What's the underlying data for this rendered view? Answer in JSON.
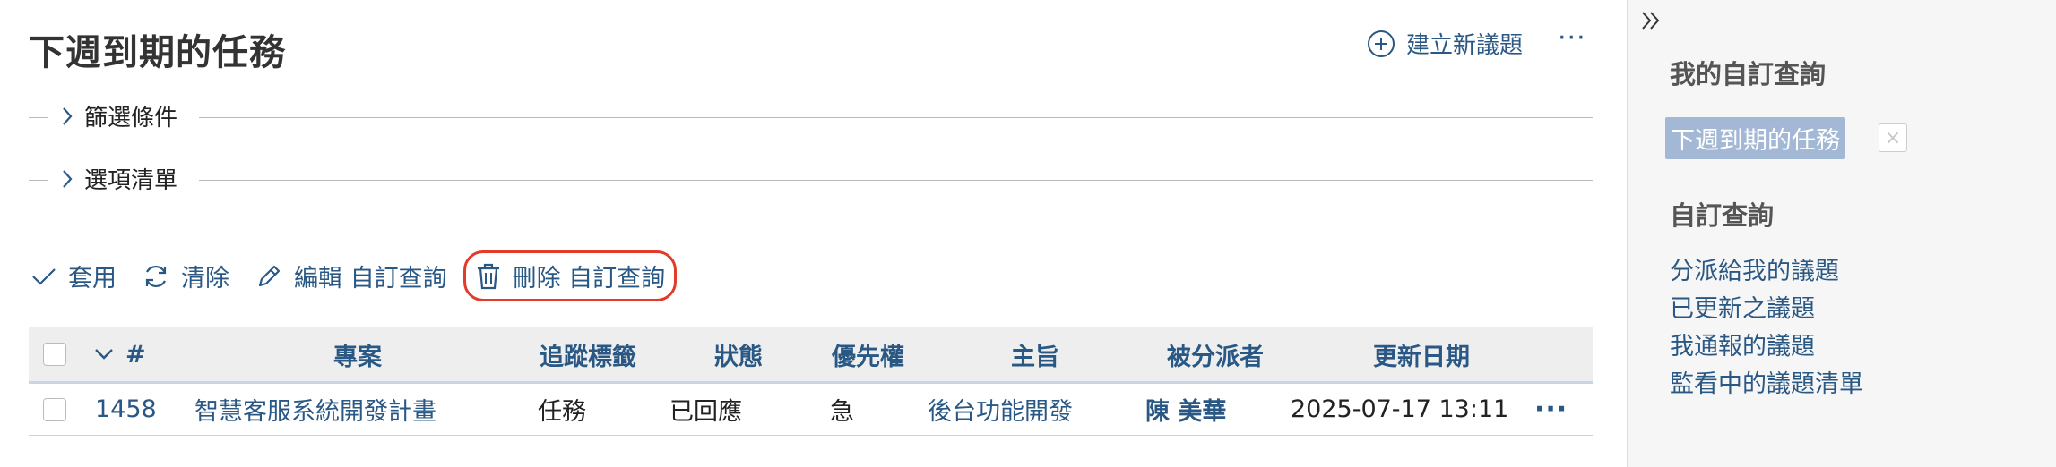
{
  "page": {
    "title": "下週到期的任務",
    "new_issue_label": "建立新議題",
    "more_label": "···"
  },
  "filters": {
    "filter_legend": "篩選條件",
    "options_legend": "選項清單"
  },
  "actions": {
    "apply": "套用",
    "clear": "清除",
    "edit": "編輯 自訂查詢",
    "delete": "刪除 自訂查詢"
  },
  "table": {
    "headers": [
      "#",
      "專案",
      "追蹤標籤",
      "狀態",
      "優先權",
      "主旨",
      "被分派者",
      "更新日期"
    ],
    "rows": [
      {
        "id": "1458",
        "project": "智慧客服系統開發計畫",
        "tracker": "任務",
        "status": "已回應",
        "priority": "急",
        "subject": "後台功能開發",
        "assignee": "陳 美華",
        "updated": "2025-07-17 13:11",
        "more": "···"
      }
    ]
  },
  "sidebar": {
    "my_queries_title": "我的自訂查詢",
    "current_query": "下週到期的任務",
    "remove_label": "×",
    "queries_title": "自訂查詢",
    "links": [
      "分派給我的議題",
      "已更新之議題",
      "我通報的議題",
      "監看中的議題清單"
    ]
  },
  "colors": {
    "link": "#2a5885",
    "highlight_ring": "#e23b2a",
    "tag_bg": "#a3b8d4"
  }
}
